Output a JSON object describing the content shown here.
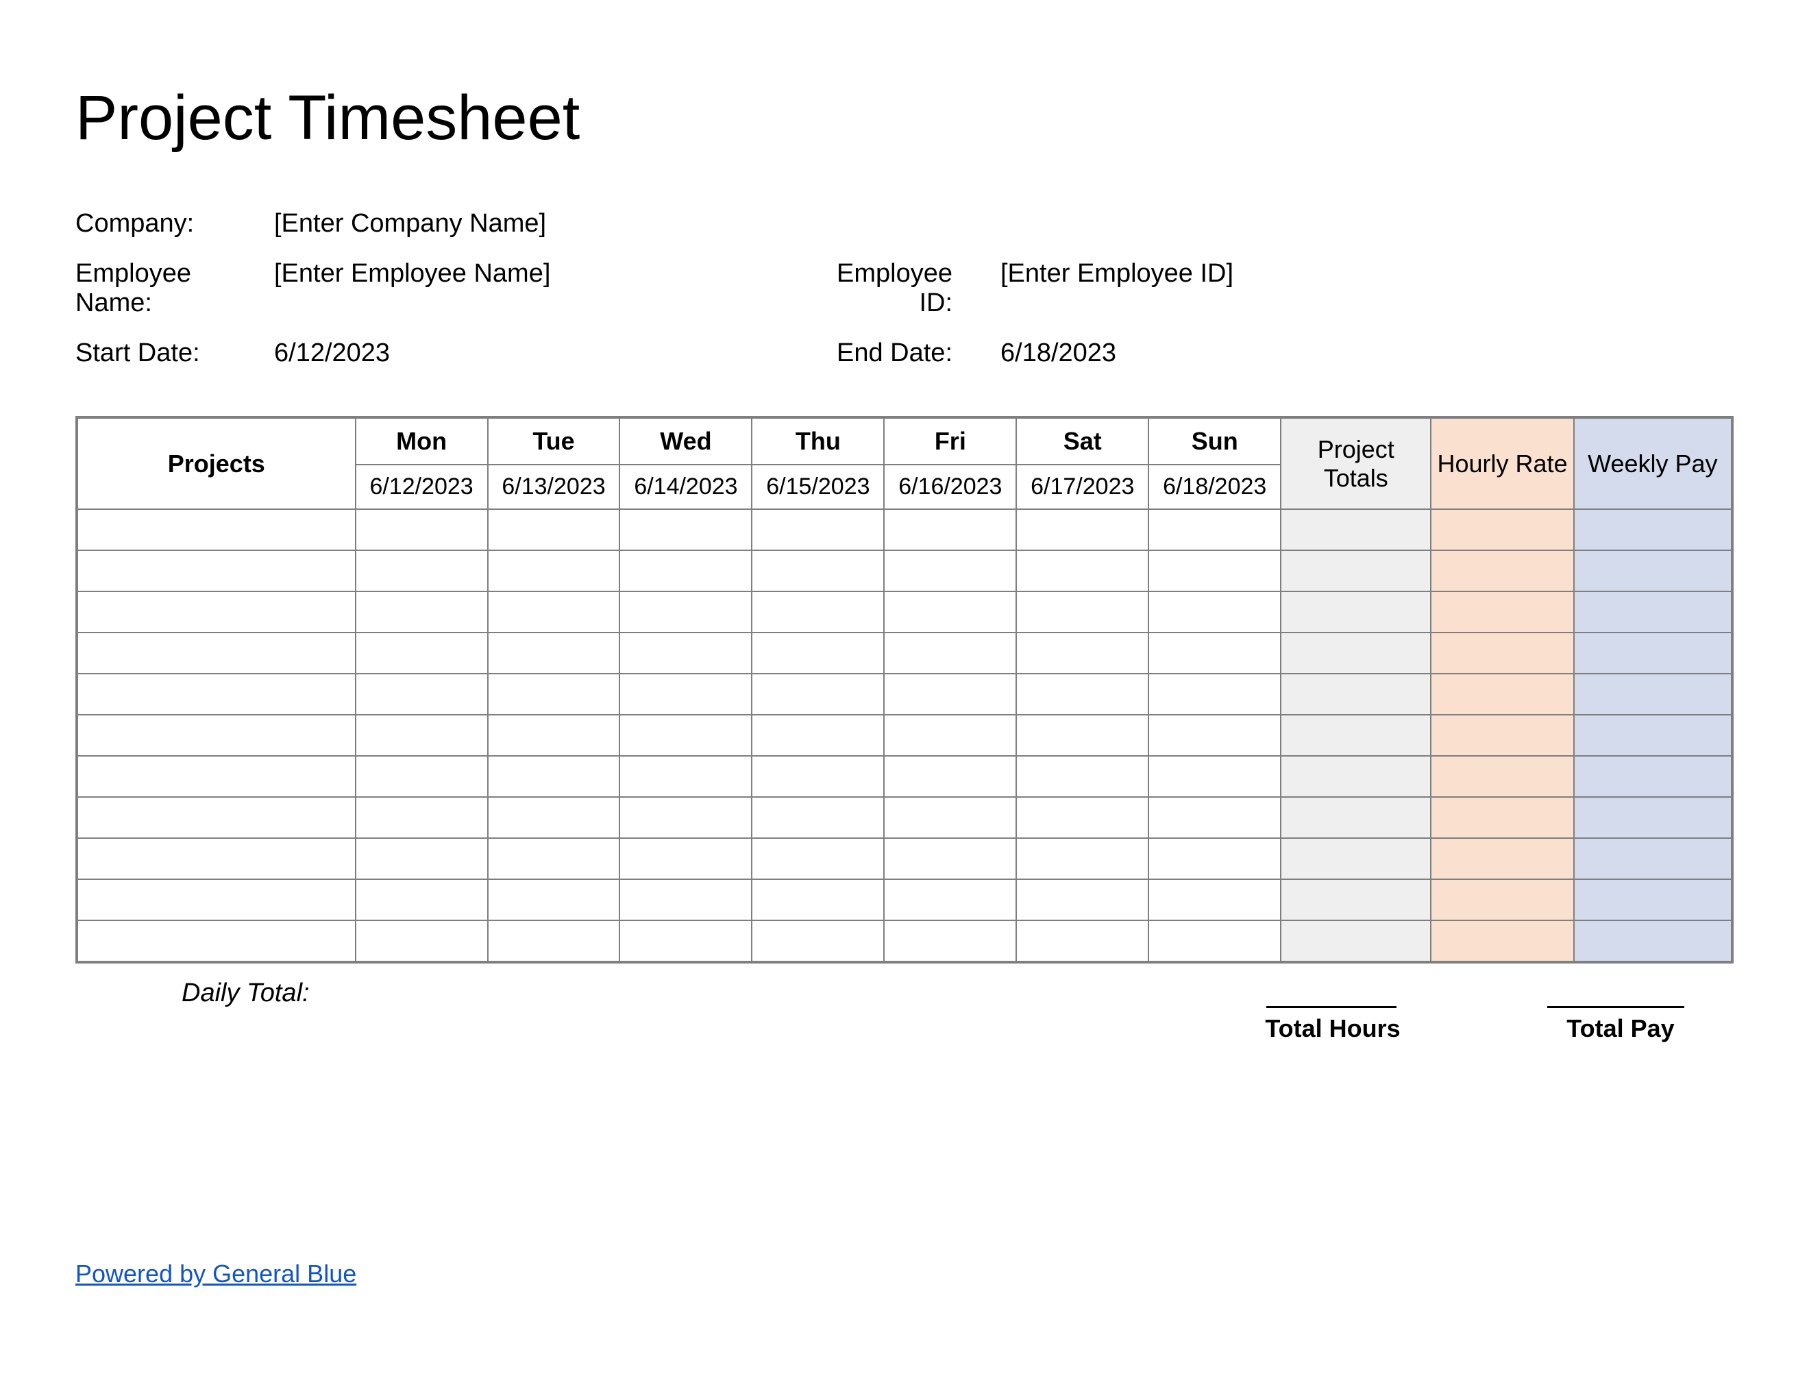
{
  "title": "Project Timesheet",
  "info": {
    "company_label": "Company:",
    "company_value": "[Enter Company Name]",
    "employee_name_label": "Employee Name:",
    "employee_name_value": "[Enter Employee Name]",
    "employee_id_label": "Employee ID:",
    "employee_id_value": "[Enter Employee ID]",
    "start_date_label": "Start Date:",
    "start_date_value": "6/12/2023",
    "end_date_label": "End Date:",
    "end_date_value": "6/18/2023"
  },
  "table": {
    "projects_header": "Projects",
    "days": [
      {
        "name": "Mon",
        "date": "6/12/2023"
      },
      {
        "name": "Tue",
        "date": "6/13/2023"
      },
      {
        "name": "Wed",
        "date": "6/14/2023"
      },
      {
        "name": "Thu",
        "date": "6/15/2023"
      },
      {
        "name": "Fri",
        "date": "6/16/2023"
      },
      {
        "name": "Sat",
        "date": "6/17/2023"
      },
      {
        "name": "Sun",
        "date": "6/18/2023"
      }
    ],
    "project_totals_header": "Project Totals",
    "hourly_rate_header": "Hourly Rate",
    "weekly_pay_header": "Weekly Pay",
    "rows": [
      {
        "project": "",
        "hours": [
          "",
          "",
          "",
          "",
          "",
          "",
          ""
        ],
        "total": "",
        "rate": "",
        "pay": ""
      },
      {
        "project": "",
        "hours": [
          "",
          "",
          "",
          "",
          "",
          "",
          ""
        ],
        "total": "",
        "rate": "",
        "pay": ""
      },
      {
        "project": "",
        "hours": [
          "",
          "",
          "",
          "",
          "",
          "",
          ""
        ],
        "total": "",
        "rate": "",
        "pay": ""
      },
      {
        "project": "",
        "hours": [
          "",
          "",
          "",
          "",
          "",
          "",
          ""
        ],
        "total": "",
        "rate": "",
        "pay": ""
      },
      {
        "project": "",
        "hours": [
          "",
          "",
          "",
          "",
          "",
          "",
          ""
        ],
        "total": "",
        "rate": "",
        "pay": ""
      },
      {
        "project": "",
        "hours": [
          "",
          "",
          "",
          "",
          "",
          "",
          ""
        ],
        "total": "",
        "rate": "",
        "pay": ""
      },
      {
        "project": "",
        "hours": [
          "",
          "",
          "",
          "",
          "",
          "",
          ""
        ],
        "total": "",
        "rate": "",
        "pay": ""
      },
      {
        "project": "",
        "hours": [
          "",
          "",
          "",
          "",
          "",
          "",
          ""
        ],
        "total": "",
        "rate": "",
        "pay": ""
      },
      {
        "project": "",
        "hours": [
          "",
          "",
          "",
          "",
          "",
          "",
          ""
        ],
        "total": "",
        "rate": "",
        "pay": ""
      },
      {
        "project": "",
        "hours": [
          "",
          "",
          "",
          "",
          "",
          "",
          ""
        ],
        "total": "",
        "rate": "",
        "pay": ""
      },
      {
        "project": "",
        "hours": [
          "",
          "",
          "",
          "",
          "",
          "",
          ""
        ],
        "total": "",
        "rate": "",
        "pay": ""
      }
    ]
  },
  "footer": {
    "daily_total_label": "Daily Total:",
    "total_hours_label": "Total Hours",
    "total_pay_label": "Total Pay",
    "powered_by": "Powered by General Blue"
  }
}
